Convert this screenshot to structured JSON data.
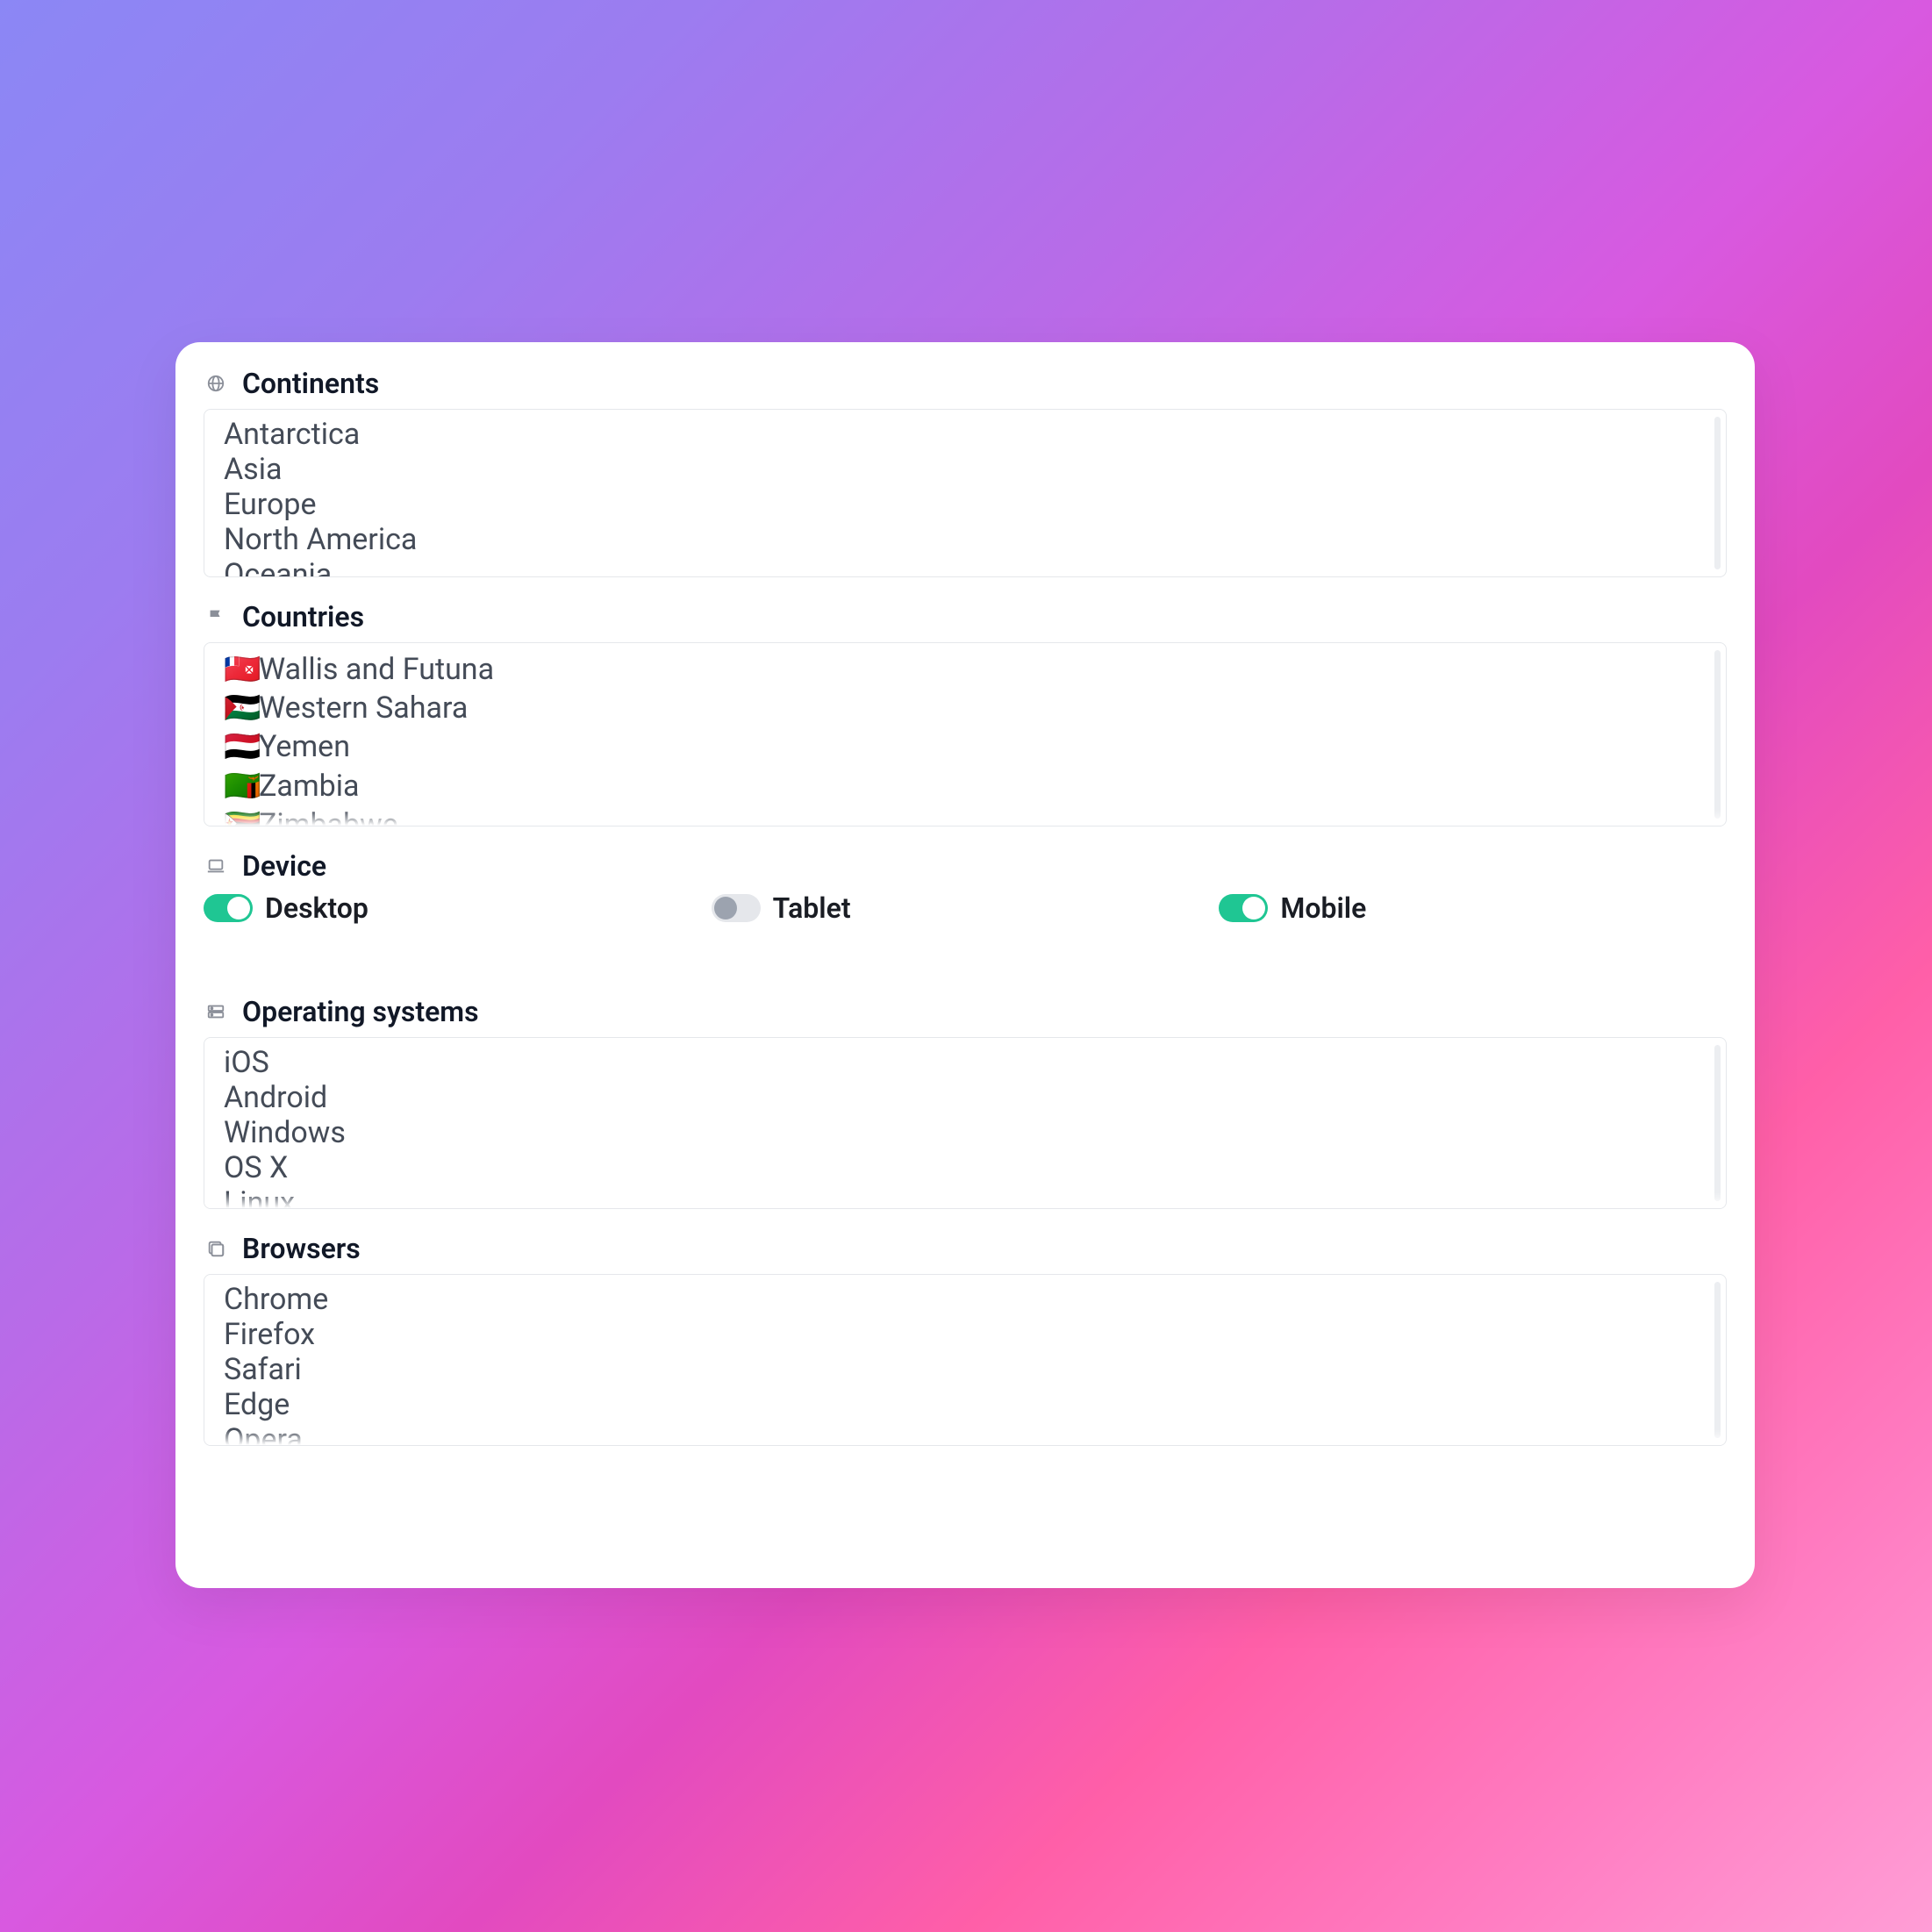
{
  "sections": {
    "continents": {
      "title": "Continents",
      "items": [
        "Antarctica",
        "Asia",
        "Europe",
        "North America",
        "Oceania"
      ]
    },
    "countries": {
      "title": "Countries",
      "items": [
        {
          "flag": "🇼🇫",
          "name": "Wallis and Futuna"
        },
        {
          "flag": "🇪🇭",
          "name": "Western Sahara"
        },
        {
          "flag": "🇾🇪",
          "name": "Yemen"
        },
        {
          "flag": "🇿🇲",
          "name": "Zambia"
        },
        {
          "flag": "🇿🇼",
          "name": "Zimbabwe"
        }
      ]
    },
    "device": {
      "title": "Device",
      "toggles": [
        {
          "label": "Desktop",
          "on": true
        },
        {
          "label": "Tablet",
          "on": false
        },
        {
          "label": "Mobile",
          "on": true
        }
      ]
    },
    "os": {
      "title": "Operating systems",
      "items": [
        "iOS",
        "Android",
        "Windows",
        "OS X",
        "Linux"
      ]
    },
    "browsers": {
      "title": "Browsers",
      "items": [
        "Chrome",
        "Firefox",
        "Safari",
        "Edge",
        "Opera"
      ]
    }
  }
}
